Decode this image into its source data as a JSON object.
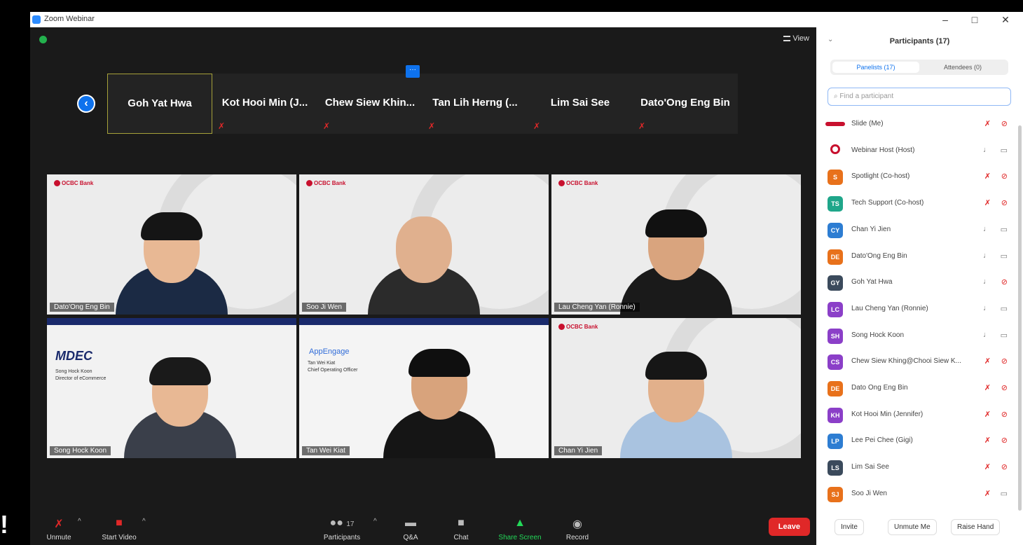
{
  "window": {
    "title": "Zoom Webinar",
    "min": "–",
    "max": "□",
    "close": "✕"
  },
  "view_label": "View",
  "thumbnails": [
    {
      "name": "Goh Yat Hwa"
    },
    {
      "name": "Kot Hooi Min (J..."
    },
    {
      "name": "Chew Siew Khin..."
    },
    {
      "name": "Tan Lih Herng (..."
    },
    {
      "name": "Lim Sai See"
    },
    {
      "name": "Dato'Ong Eng Bin"
    }
  ],
  "tiles": [
    {
      "label": "Dato'Ong Eng Bin",
      "bank": "OCBC Bank"
    },
    {
      "label": "Soo Ji Wen",
      "bank": "OCBC Bank"
    },
    {
      "label": "Lau Cheng Yan (Ronnie)",
      "bank": "OCBC Bank"
    },
    {
      "label": "Song Hock Koon",
      "logo": "MDEC",
      "slide1": "Song Hock Koon",
      "slide2": "Director of eCommerce"
    },
    {
      "label": "Tan Wei Kiat",
      "logo": "AppEngage",
      "slide1": "Tan Wei Kiat",
      "slide2": "Chief Operating Officer"
    },
    {
      "label": "Chan Yi Jien",
      "bank": "OCBC Bank"
    }
  ],
  "toolbar": {
    "unmute": "Unmute",
    "start_video": "Start Video",
    "participants": "Participants",
    "participants_count": "17",
    "qa": "Q&A",
    "chat": "Chat",
    "share": "Share Screen",
    "record": "Record",
    "leave": "Leave"
  },
  "panel": {
    "title": "Participants (17)",
    "tab_panelists": "Panelists (17)",
    "tab_attendees": "Attendees (0)",
    "search_placeholder": "Find a participant",
    "participants": [
      {
        "initials": "",
        "name": "Slide (Me)",
        "color": "#c8102e",
        "mic_muted": true,
        "cam_off": true,
        "logo": "slide"
      },
      {
        "initials": "",
        "name": "Webinar Host (Host)",
        "color": "#c8102e",
        "mic_muted": false,
        "cam_off": false,
        "logo": "host"
      },
      {
        "initials": "S",
        "name": "Spotlight (Co-host)",
        "color": "#e8711b",
        "mic_muted": true,
        "cam_off": true
      },
      {
        "initials": "TS",
        "name": "Tech Support (Co-host)",
        "color": "#1fa68a",
        "mic_muted": true,
        "cam_off": true
      },
      {
        "initials": "CY",
        "name": "Chan Yi Jien",
        "color": "#2d7dd2",
        "mic_muted": false,
        "cam_off": false
      },
      {
        "initials": "DE",
        "name": "Dato'Ong Eng Bin",
        "color": "#e8711b",
        "mic_muted": false,
        "cam_off": false
      },
      {
        "initials": "GY",
        "name": "Goh Yat Hwa",
        "color": "#3b4a5c",
        "mic_muted": false,
        "cam_off": true
      },
      {
        "initials": "LC",
        "name": "Lau Cheng Yan (Ronnie)",
        "color": "#8b3fc8",
        "mic_muted": false,
        "cam_off": false
      },
      {
        "initials": "SH",
        "name": "Song Hock Koon",
        "color": "#8b3fc8",
        "mic_muted": false,
        "cam_off": false
      },
      {
        "initials": "CS",
        "name": "Chew Siew Khing@Chooi Siew K...",
        "color": "#8b3fc8",
        "mic_muted": true,
        "cam_off": true
      },
      {
        "initials": "DE",
        "name": "Dato Ong Eng Bin",
        "color": "#e8711b",
        "mic_muted": true,
        "cam_off": true
      },
      {
        "initials": "KH",
        "name": "Kot Hooi Min (Jennifer)",
        "color": "#8b3fc8",
        "mic_muted": true,
        "cam_off": true
      },
      {
        "initials": "LP",
        "name": "Lee Pei Chee (Gigi)",
        "color": "#2d7dd2",
        "mic_muted": true,
        "cam_off": true
      },
      {
        "initials": "LS",
        "name": "Lim Sai See",
        "color": "#3b4a5c",
        "mic_muted": true,
        "cam_off": true
      },
      {
        "initials": "SJ",
        "name": "Soo Ji Wen",
        "color": "#e8711b",
        "mic_muted": true,
        "cam_off": false
      }
    ],
    "invite": "Invite",
    "unmute_me": "Unmute Me",
    "raise_hand": "Raise Hand"
  }
}
